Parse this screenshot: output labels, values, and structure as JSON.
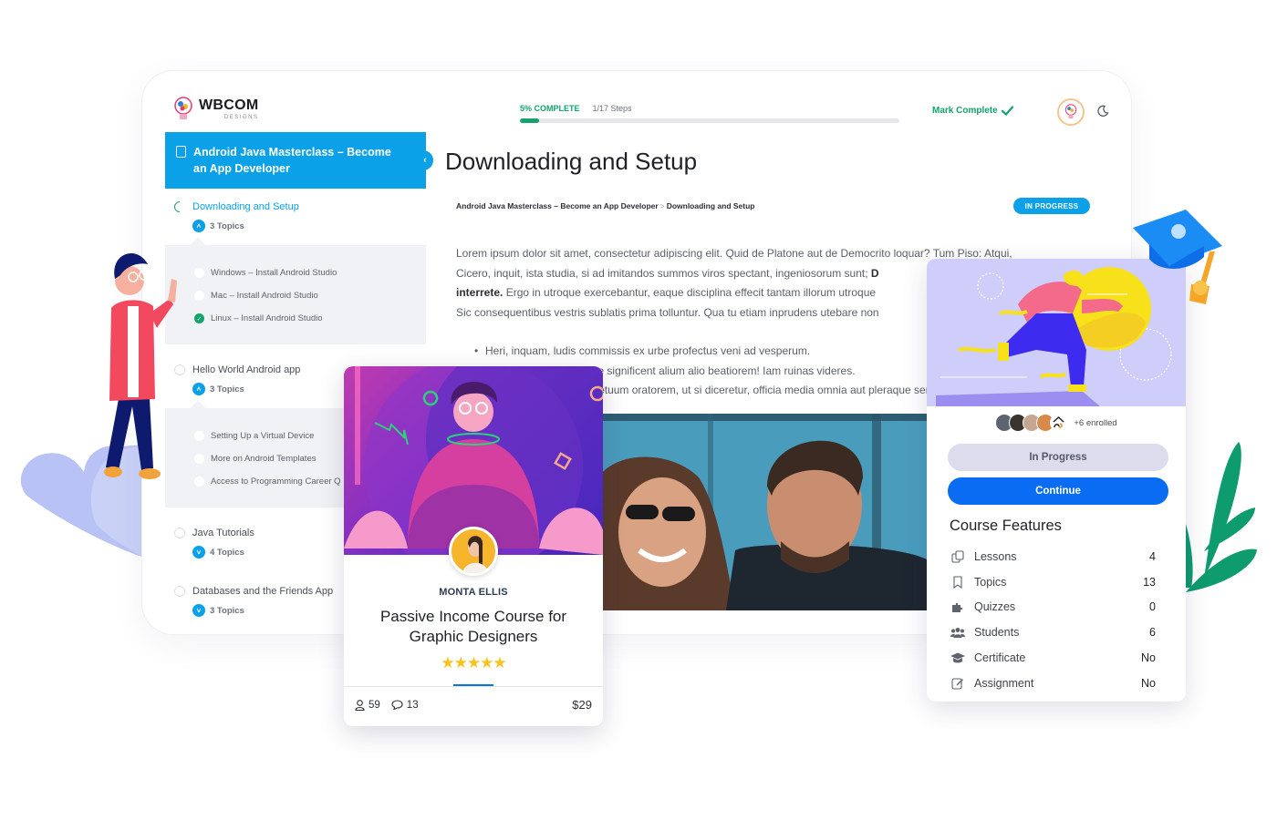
{
  "brand": {
    "name": "WBCOM",
    "tagline": "DESIGNS"
  },
  "header": {
    "progress_label": "5% COMPLETE",
    "progress_percent": 5,
    "steps_label": "1/17 Steps",
    "mark_complete_label": "Mark Complete",
    "colors": {
      "accent_green": "#13a36b",
      "accent_blue": "#0aa1e8"
    }
  },
  "sidebar": {
    "course_title": "Android Java Masterclass – Become an App Developer",
    "lessons": [
      {
        "title": "Downloading and Setup",
        "state": "in-progress",
        "topics_label": "3 Topics",
        "expanded": true,
        "topics": [
          {
            "title": "Windows – Install Android Studio",
            "complete": false
          },
          {
            "title": "Mac – Install Android Studio",
            "complete": false
          },
          {
            "title": "Linux – Install Android Studio",
            "complete": true
          }
        ]
      },
      {
        "title": "Hello World Android app",
        "state": "not-started",
        "topics_label": "3 Topics",
        "expanded": true,
        "topics": [
          {
            "title": "Setting Up a Virtual Device",
            "complete": false
          },
          {
            "title": "More on Android Templates",
            "complete": false
          },
          {
            "title": "Access to Programming Career Q",
            "complete": false
          }
        ]
      },
      {
        "title": "Java Tutorials",
        "state": "not-started",
        "topics_label": "4 Topics",
        "expanded": false
      },
      {
        "title": "Databases and the Friends App",
        "state": "not-started",
        "topics_label": "3 Topics",
        "expanded": false
      }
    ]
  },
  "content": {
    "title": "Downloading and Setup",
    "breadcrumb": [
      "Android Java Masterclass – Become an App Developer",
      "Downloading and Setup"
    ],
    "breadcrumb_sep": ">",
    "status_badge": "IN PROGRESS",
    "paragraph_lines": [
      "Lorem ipsum dolor sit amet, consectetur adipiscing elit. Quid de Platone aut de Democrito loquar? Tum Piso: Atqui,",
      "Cicero, inquit, ista studia, si ad imitandos summos viros spectant, ingeniosorum sunt;",
      "Ergo in utroque exercebantur, eaque disciplina effecit tantam illorum utroque",
      "Sic consequentibus vestris sublatis prima tolluntur. Qua tu etiam inprudens utebare non"
    ],
    "bold_fragments": [
      "D",
      "interrete."
    ],
    "bullets": [
      "Heri, inquam, ludis commissis ex urbe profectus veni ad vesperum.",
      "Quam multa vides, quae significent alium alio beatiorem! Iam ruinas videres.",
      "Quasi vero, inquit, perpetuum oratorem, ut si diceretur, officia media omnia aut pleraque servante"
    ]
  },
  "course_card": {
    "author": "MONTA ELLIS",
    "title_line1": "Passive Income Course for",
    "title_line2": "Graphic Designers",
    "rating": 5,
    "rating_stars": "★★★★★",
    "students": "59",
    "comments": "13",
    "price": "$29"
  },
  "side_card": {
    "enrolled_label": "+6 enrolled",
    "in_progress_label": "In Progress",
    "continue_label": "Continue",
    "features_title": "Course Features",
    "features": [
      {
        "icon": "lessons-icon",
        "glyph": "❐",
        "label": "Lessons",
        "value": "4"
      },
      {
        "icon": "bookmark-icon",
        "glyph": "🔖",
        "label": "Topics",
        "value": "13"
      },
      {
        "icon": "puzzle-icon",
        "glyph": "✚",
        "label": "Quizzes",
        "value": "0"
      },
      {
        "icon": "users-icon",
        "glyph": "👥",
        "label": "Students",
        "value": "6"
      },
      {
        "icon": "graduation-cap-icon",
        "glyph": "🎓",
        "label": "Certificate",
        "value": "No"
      },
      {
        "icon": "edit-icon",
        "glyph": "✎",
        "label": "Assignment",
        "value": "No"
      }
    ]
  }
}
